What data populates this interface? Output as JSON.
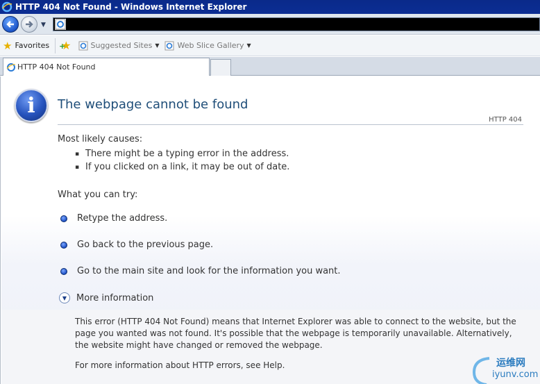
{
  "window": {
    "title": "HTTP 404 Not Found - Windows Internet Explorer"
  },
  "favorites_bar": {
    "favorites_label": "Favorites",
    "items": [
      {
        "label": "Suggested Sites"
      },
      {
        "label": "Web Slice Gallery"
      }
    ]
  },
  "tab": {
    "label": "HTTP 404 Not Found"
  },
  "page": {
    "title": "The webpage cannot be found",
    "http_code": "HTTP 404",
    "causes_heading": "Most likely causes:",
    "causes": [
      "There might be a typing error in the address.",
      "If you clicked on a link, it may be out of date."
    ],
    "try_heading": "What you can try:",
    "try_items": [
      "Retype the address.",
      "Go back to the previous page.",
      "Go to the main site and look for the information you want."
    ],
    "more_info_label": "More information",
    "more_info_text": "This error (HTTP 404 Not Found) means that Internet Explorer was able to connect to the website, but the page you wanted was not found. It's possible that the webpage is temporarily unavailable. Alternatively, the website might have changed or removed the webpage.",
    "more_info_help": "For more information about HTTP errors, see Help."
  },
  "watermark": {
    "cn": "运维网",
    "en": "iyunv.com"
  }
}
